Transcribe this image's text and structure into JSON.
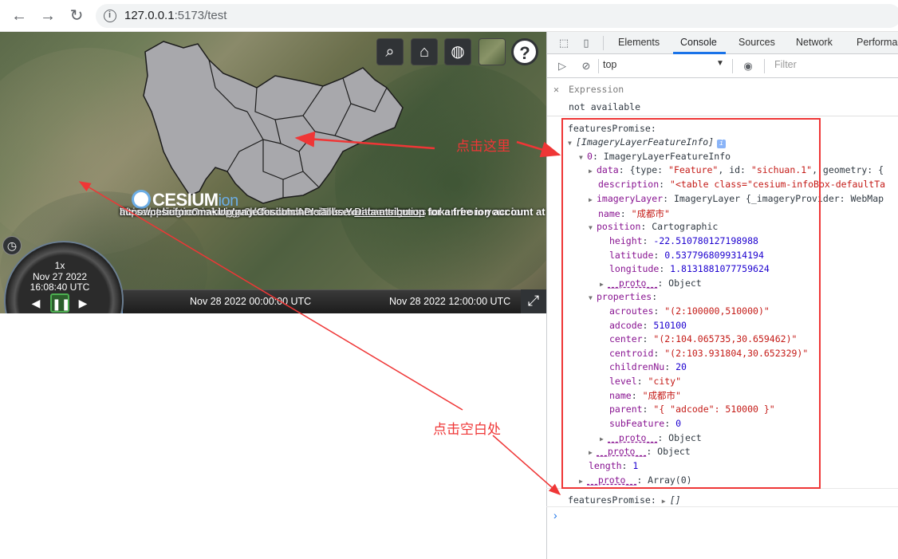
{
  "browser": {
    "url_host": "127.0.0.1",
    "url_rest": ":5173/test",
    "back_icon": "arrow-left-icon",
    "forward_icon": "arrow-right-icon",
    "reload_icon": "reload-icon"
  },
  "viewer": {
    "logo_text": "CESIUM",
    "logo_ion": "ion",
    "credit_line1": "This application is using Cesium's default ion access token.",
    "credit_line2_a": "Please assign",
    "credit_line2_b": "Cesium.Ion.defaultAccessToken",
    "credit_line2_c": "with an access token from your ion",
    "credit_line3": "account before making any Cesium API calls. You can sign up for a free ion account at",
    "credit_line4": "https://cesium.com.",
    "credit_line4_b": "• Upgrade for commercial use.",
    "credit_link": "Data attribution",
    "timeline_tick1": "Nov 28 2022 00:00:00 UTC",
    "timeline_tick2": "Nov 28 2022 12:00:00 UTC",
    "anim_speed": "1x",
    "anim_date": "Nov 27 2022",
    "anim_time": "16:08:40 UTC",
    "toolbar_icons": [
      "search-icon",
      "home-icon",
      "globe-icon",
      "layer-picker-icon",
      "help-icon"
    ],
    "help_label": "?"
  },
  "devtools": {
    "tabs": [
      "Elements",
      "Console",
      "Sources",
      "Network",
      "Performa"
    ],
    "active_tab": "Console",
    "context": "top",
    "filter_placeholder": "Filter",
    "expression_label": "Expression",
    "expression_value": "not available",
    "log": {
      "l1": "featuresPromise:",
      "l2": "[ImageryLayerFeatureInfo]",
      "l3_key": "0",
      "l3_val": "ImageryLayerFeatureInfo",
      "l4_key": "data",
      "l4_a": "{type: ",
      "l4_s1": "\"Feature\"",
      "l4_b": ", id: ",
      "l4_s2": "\"sichuan.1\"",
      "l4_c": ", geometry: {",
      "l5_key": "description",
      "l5_val": "\"<table class=\"cesium-infoBox-defaultTa",
      "l6_key": "imageryLayer",
      "l6_val": "ImageryLayer {_imageryProvider: WebMap",
      "l7_key": "name",
      "l7_val": "\"成都市\"",
      "l8_key": "position",
      "l8_val": "Cartographic",
      "l9_key": "height",
      "l9_val": "-22.510780127198988",
      "l10_key": "latitude",
      "l10_val": "0.5377968099314194",
      "l11_key": "longitude",
      "l11_val": "1.8131881077759624",
      "proto": "__proto__",
      "proto_obj": "Object",
      "l13_key": "properties",
      "p1_key": "acroutes",
      "p1_val": "\"(2:100000,510000)\"",
      "p2_key": "adcode",
      "p2_val": "510100",
      "p3_key": "center",
      "p3_val": "\"(2:104.065735,30.659462)\"",
      "p4_key": "centroid",
      "p4_val": "\"(2:103.931804,30.652329)\"",
      "p5_key": "childrenNu",
      "p5_val": "20",
      "p6_key": "level",
      "p6_val": "\"city\"",
      "p7_key": "name",
      "p7_val": "\"成都市\"",
      "p8_key": "parent",
      "p8_val": "\"{ \"adcode\": 510000 }\"",
      "p9_key": "subFeature",
      "p9_val": "0",
      "len_key": "length",
      "len_val": "1",
      "arr_proto": "Array(0)",
      "l_last": "featuresPromise:",
      "l_last_val": "[]"
    }
  },
  "annotations": {
    "click_here": "点击这里",
    "click_blank": "点击空白处",
    "color": "#ef3636"
  }
}
